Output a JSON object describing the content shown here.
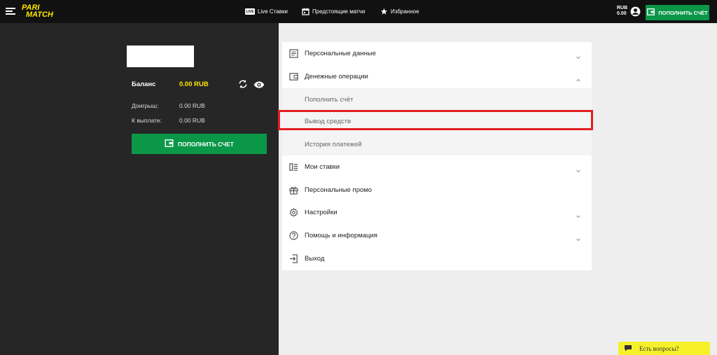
{
  "header": {
    "logo_line1": "PARI",
    "logo_line2": "MATCH",
    "nav": {
      "live_badge": "LIVE",
      "live": "Live Ставки",
      "upcoming": "Предстоящие матчи",
      "favorites": "Избранное"
    },
    "currency": "RUB",
    "balance": "0.00",
    "deposit_button": "ПОПОЛНИТЬ СЧЁТ"
  },
  "account": {
    "balance_label": "Баланс",
    "balance_value": "0.00 RUB",
    "rows": [
      {
        "label": "Доигрыш:",
        "value": "0.00 RUB"
      },
      {
        "label": "К выплате:",
        "value": "0.00 RUB"
      }
    ],
    "deposit_button": "ПОПОЛНИТЬ СЧЕТ"
  },
  "menu": {
    "personal_data": "Персональные данные",
    "money_operations": "Денежные операции",
    "sub_deposit": "Пополнить счёт",
    "sub_withdraw": "Вывод средств",
    "sub_history": "История платежей",
    "my_bets": "Мои ставки",
    "personal_promo": "Персональные промо",
    "settings": "Настройки",
    "help": "Помощь и информация",
    "logout": "Выход"
  },
  "help_widget": {
    "label": "Есть вопросы?"
  },
  "colors": {
    "brand_yellow": "#ffe600",
    "green": "#0a9748",
    "highlight_red": "#e31e24"
  }
}
